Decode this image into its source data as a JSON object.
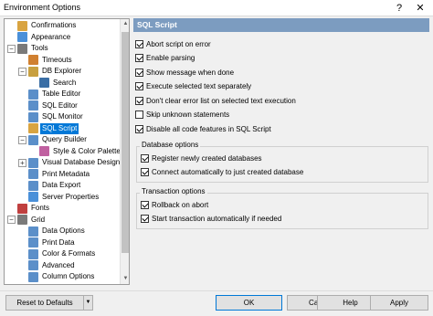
{
  "window": {
    "title": "Environment Options",
    "help_glyph": "?",
    "close_glyph": "✕"
  },
  "tree": {
    "items": [
      {
        "label": "Confirmations",
        "icon": "confirmations-icon",
        "color": "#d9a441"
      },
      {
        "label": "Appearance",
        "icon": "appearance-icon",
        "color": "#4a90d9"
      },
      {
        "label": "Tools",
        "icon": "tools-icon",
        "color": "#7a7a7a",
        "expander": "−"
      },
      {
        "label": "Timeouts",
        "icon": "timeouts-icon",
        "color": "#d08030"
      },
      {
        "label": "DB Explorer",
        "icon": "db-explorer-icon",
        "color": "#c8a040",
        "expander": "−"
      },
      {
        "label": "Search",
        "icon": "search-icon",
        "color": "#3a6ea5"
      },
      {
        "label": "Table Editor",
        "icon": "table-editor-icon",
        "color": "#5b8fc9"
      },
      {
        "label": "SQL Editor",
        "icon": "sql-editor-icon",
        "color": "#5b8fc9"
      },
      {
        "label": "SQL Monitor",
        "icon": "sql-monitor-icon",
        "color": "#5b8fc9"
      },
      {
        "label": "SQL Script",
        "icon": "sql-script-icon",
        "color": "#d9a441"
      },
      {
        "label": "Query Builder",
        "icon": "query-builder-icon",
        "color": "#5b8fc9",
        "expander": "−"
      },
      {
        "label": "Style & Color Palette",
        "icon": "style-palette-icon",
        "color": "#c060a0"
      },
      {
        "label": "Visual Database Designer",
        "icon": "vdd-icon",
        "color": "#5b8fc9",
        "expander": "+"
      },
      {
        "label": "Print Metadata",
        "icon": "print-metadata-icon",
        "color": "#5b8fc9"
      },
      {
        "label": "Data Export",
        "icon": "data-export-icon",
        "color": "#5b8fc9"
      },
      {
        "label": "Server Properties",
        "icon": "server-properties-icon",
        "color": "#4a90d9"
      },
      {
        "label": "Fonts",
        "icon": "fonts-icon",
        "color": "#c04040"
      },
      {
        "label": "Grid",
        "icon": "grid-icon",
        "color": "#7a7a7a",
        "expander": "−"
      },
      {
        "label": "Data Options",
        "icon": "data-options-icon",
        "color": "#5b8fc9"
      },
      {
        "label": "Print Data",
        "icon": "print-data-icon",
        "color": "#5b8fc9"
      },
      {
        "label": "Color & Formats",
        "icon": "color-formats-icon",
        "color": "#5b8fc9"
      },
      {
        "label": "Advanced",
        "icon": "advanced-icon",
        "color": "#5b8fc9"
      },
      {
        "label": "Column Options",
        "icon": "column-options-icon",
        "color": "#5b8fc9"
      }
    ],
    "selected_index": 9,
    "scroll_up_glyph": "▲",
    "scroll_down_glyph": "▼"
  },
  "panel": {
    "title": "SQL Script",
    "options": [
      {
        "label": "Abort script on error",
        "checked": true
      },
      {
        "label": "Enable parsing",
        "checked": true
      },
      {
        "label": "Show message when done",
        "checked": true
      },
      {
        "label": "Execute selected text separately",
        "checked": true
      },
      {
        "label": "Don't clear error list on selected text execution",
        "checked": true
      },
      {
        "label": "Skip unknown statements",
        "checked": false
      },
      {
        "label": "Disable all code features in SQL Script",
        "checked": true
      }
    ],
    "database_options": {
      "title": "Database options",
      "options": [
        {
          "label": "Register newly created databases",
          "checked": true
        },
        {
          "label": "Connect automatically to just created database",
          "checked": true
        }
      ]
    },
    "transaction_options": {
      "title": "Transaction options",
      "options": [
        {
          "label": "Rollback on abort",
          "checked": true
        },
        {
          "label": "Start transaction automatically if needed",
          "checked": true
        }
      ]
    }
  },
  "footer": {
    "reset_label": "Reset to Defaults",
    "reset_dropdown_glyph": "▼",
    "ok_label": "OK",
    "cancel_label": "Cancel",
    "help_label": "Help",
    "apply_label": "Apply"
  }
}
